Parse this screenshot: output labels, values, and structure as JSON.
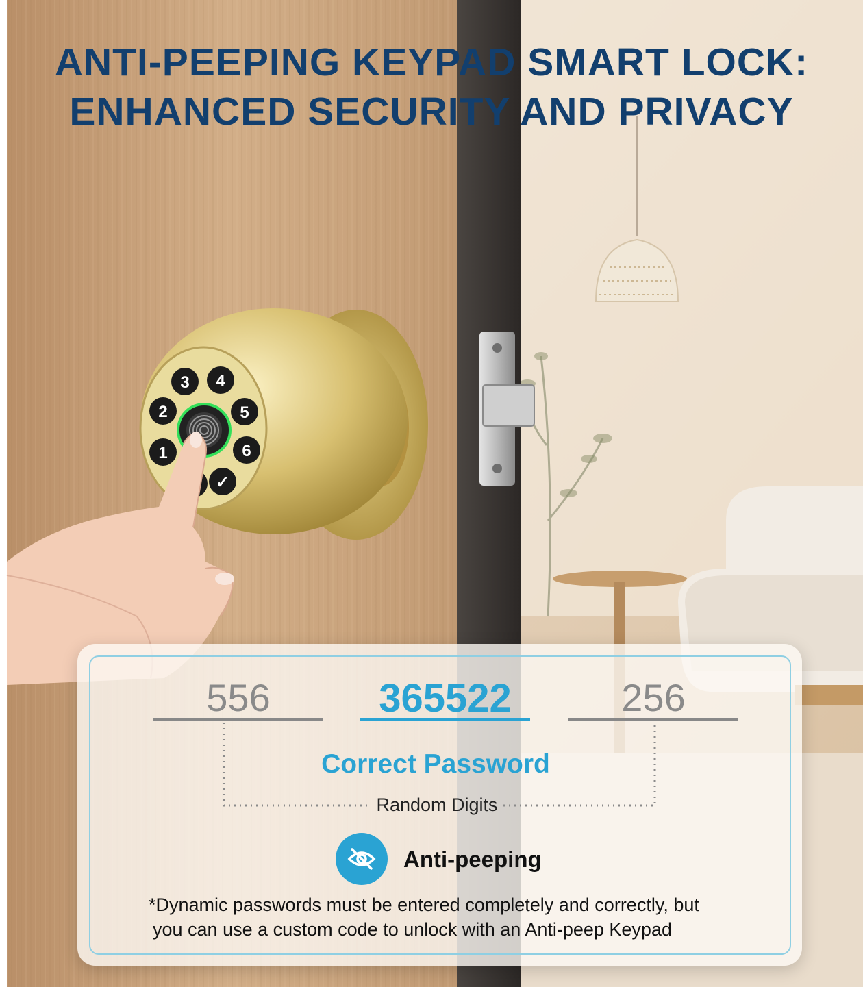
{
  "headline": {
    "line1": "ANTI-PEEPING KEYPAD SMART LOCK:",
    "line2": "ENHANCED SECURITY AND PRIVACY"
  },
  "keypad": {
    "keys": [
      "3",
      "4",
      "2",
      "5",
      "1",
      "6",
      "✓"
    ]
  },
  "info_card": {
    "digits_left": "556",
    "digits_center": "365522",
    "digits_right": "256",
    "correct_label": "Correct Password",
    "random_label": "Random Digits",
    "badge_label": "Anti-peeping",
    "note_line1": "*Dynamic passwords must be entered completely and correctly, but",
    "note_line2": "you can use a custom code to unlock with an Anti-peep Keypad"
  },
  "colors": {
    "headline": "#123f6e",
    "accent": "#2aa3d3",
    "card_border": "#8fcfe3",
    "brass": "#d8c071"
  },
  "icons": {
    "badge": "eye-slash-icon",
    "keypad_center": "fingerprint-icon"
  }
}
